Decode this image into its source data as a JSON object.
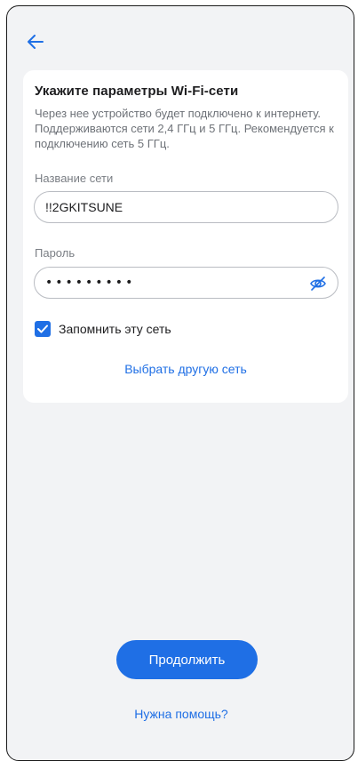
{
  "header": {
    "back_icon": "arrow-left-icon"
  },
  "card": {
    "title": "Укажите параметры Wi-Fi-сети",
    "description": "Через нее устройство будет подключено к интернету. Поддерживаются сети 2,4 ГГц и 5 ГГц. Рекомендуется к подключению сеть 5 ГГц.",
    "network_label": "Название сети",
    "network_value": "!!2GKITSUNE",
    "password_label": "Пароль",
    "password_value": "•••••••••",
    "password_toggle_icon": "eye-off-icon",
    "remember_label": "Запомнить эту сеть",
    "remember_checked": true,
    "other_network_link": "Выбрать другую сеть"
  },
  "footer": {
    "continue_label": "Продолжить",
    "help_link": "Нужна помощь?"
  },
  "colors": {
    "accent": "#1f6fe5",
    "background": "#f2f3f5",
    "card": "#ffffff",
    "text_primary": "#1d1d1f",
    "text_secondary": "#6e7278"
  }
}
